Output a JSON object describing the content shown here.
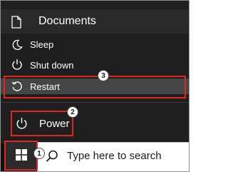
{
  "start_menu": {
    "documents": {
      "label": "Documents",
      "icon": "document-icon"
    },
    "power_options": [
      {
        "label": "Sleep",
        "icon": "moon-icon"
      },
      {
        "label": "Shut down",
        "icon": "power-icon"
      },
      {
        "label": "Restart",
        "icon": "restart-icon"
      }
    ],
    "power": {
      "label": "Power",
      "icon": "power-icon"
    }
  },
  "taskbar": {
    "start_button": {
      "icon": "windows-logo-icon"
    },
    "search": {
      "placeholder": "Type here to search",
      "icon": "search-icon"
    }
  },
  "annotations": {
    "step_badges": [
      "1",
      "2",
      "3"
    ],
    "highlight_color": "#e0261d"
  },
  "colors": {
    "menu_background": "#1f1f1f",
    "hover_background": "#454545",
    "taskbar_background": "#101010"
  }
}
